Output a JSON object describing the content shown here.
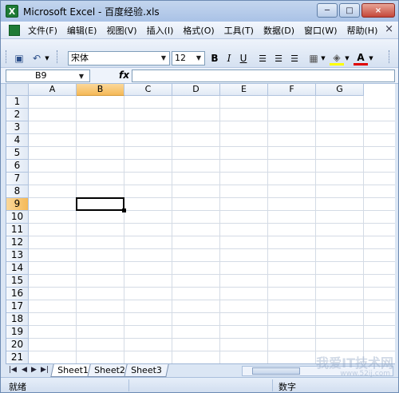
{
  "window": {
    "title": "Microsoft Excel - 百度经验.xls",
    "minimize": "─",
    "maximize": "□",
    "close": "×"
  },
  "menu": {
    "items": [
      "文件(F)",
      "编辑(E)",
      "视图(V)",
      "插入(I)",
      "格式(O)",
      "工具(T)",
      "数据(D)",
      "窗口(W)",
      "帮助(H)"
    ],
    "close_doc": "×"
  },
  "toolbar": {
    "font_name": "宋体",
    "font_size": "12",
    "bold": "B",
    "italic": "I",
    "underline": "U",
    "undo": "↶",
    "save": "▣",
    "dropdown": "▼",
    "font_color": "A",
    "fill_color": "◈",
    "borders": "▦",
    "align_left": "☰",
    "align_center": "☰",
    "align_right": "☰",
    "colors": {
      "font_color_bar": "#e00000",
      "fill_color_bar": "#ffff00"
    }
  },
  "formula_bar": {
    "name_box": "B9",
    "fx": "fx",
    "formula": ""
  },
  "grid": {
    "columns": [
      "A",
      "B",
      "C",
      "D",
      "E",
      "F",
      "G"
    ],
    "rows": [
      "1",
      "2",
      "3",
      "4",
      "5",
      "6",
      "7",
      "8",
      "9",
      "10",
      "11",
      "12",
      "13",
      "14",
      "15",
      "16",
      "17",
      "18",
      "19",
      "20",
      "21"
    ],
    "active_column": "B",
    "active_row": "9"
  },
  "sheets": {
    "tabs": [
      "Sheet1",
      "Sheet2",
      "Sheet3"
    ],
    "active": "Sheet1",
    "nav": [
      "|◀",
      "◀",
      "▶",
      "▶|"
    ]
  },
  "status": {
    "ready": "就绪",
    "mode": "数字"
  },
  "watermark": {
    "text": "我爱IT技术网",
    "url": "www.52ij.com"
  }
}
